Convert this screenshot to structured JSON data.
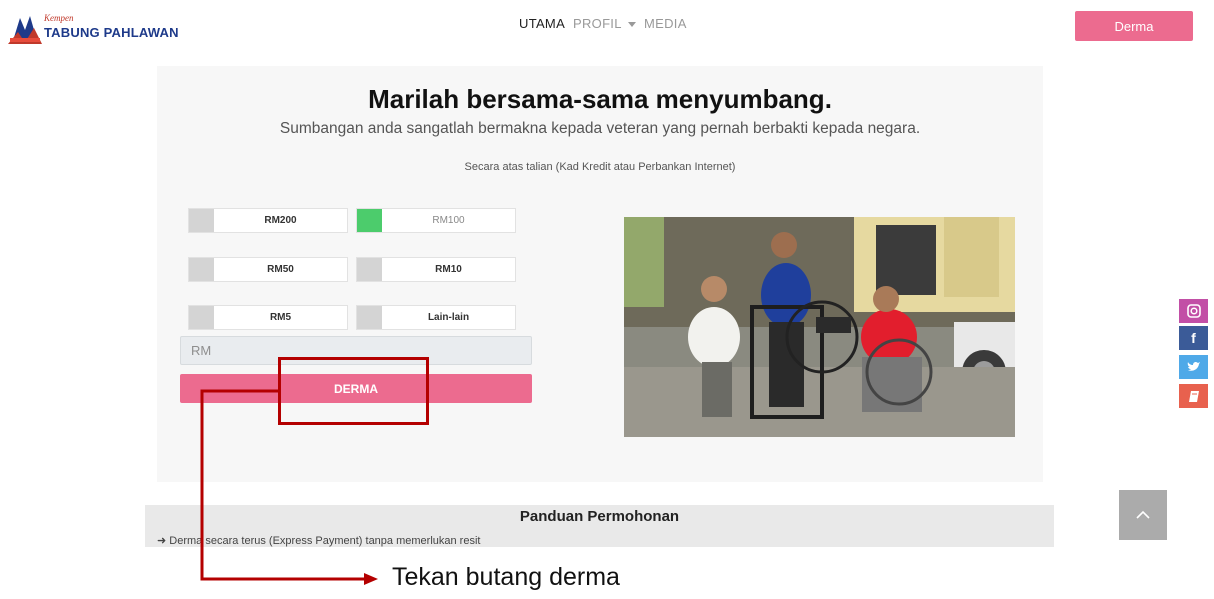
{
  "header": {
    "logo_small": "Kempen",
    "logo_main": "TABUNG PAHLAWAN",
    "nav": {
      "utama": "UTAMA",
      "profil": "PROFIL",
      "media": "MEDIA"
    },
    "derma_button": "Derma"
  },
  "main": {
    "title": "Marilah bersama-sama menyumbang.",
    "subtitle": "Sumbangan anda sangatlah bermakna kepada veteran yang pernah berbakti kepada negara.",
    "online_note": "Secara atas talian (Kad Kredit atau Perbankan Internet)",
    "amounts": [
      {
        "label": "RM200",
        "selected": false
      },
      {
        "label": "RM100",
        "selected": true
      },
      {
        "label": "RM50",
        "selected": false
      },
      {
        "label": "RM10",
        "selected": false
      },
      {
        "label": "RM5",
        "selected": false
      },
      {
        "label": "Lain-lain",
        "selected": false
      }
    ],
    "amount_placeholder": "RM",
    "submit_label": "DERMA"
  },
  "guide": {
    "title": "Panduan Permohonan",
    "item": "Derma secara terus (Express Payment) tanpa memerlukan resit"
  },
  "social": [
    "instagram-icon",
    "facebook-icon",
    "twitter-icon",
    "book-icon"
  ],
  "annotation": {
    "text": "Tekan butang derma"
  },
  "colors": {
    "accent": "#ec6b8f",
    "selected": "#4ccc6c",
    "annotation": "#b40000"
  }
}
